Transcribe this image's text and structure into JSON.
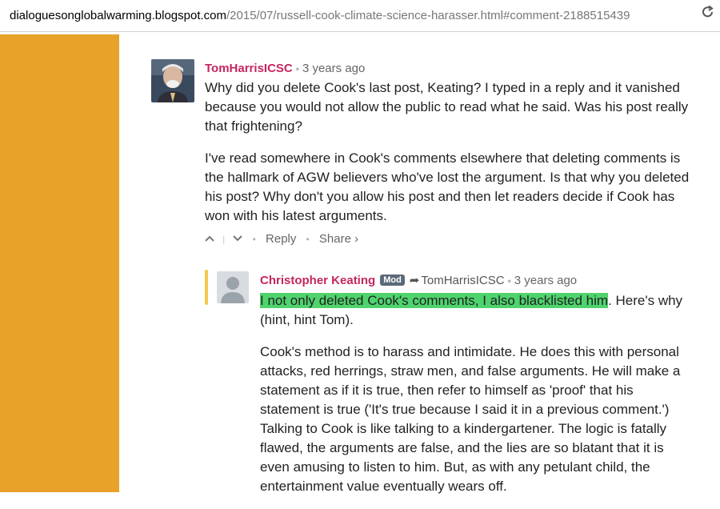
{
  "browser": {
    "url_host": "dialoguesonglobalwarming.blogspot.com",
    "url_path": "/2015/07/russell-cook-climate-science-harasser.html#comment-2188515439",
    "reload_icon": "reload-icon"
  },
  "comments": [
    {
      "author": "TomHarrisICSC",
      "time": "3 years ago",
      "avatar_icon": "user-photo-avatar",
      "paragraphs": [
        "Why did you delete Cook's last post, Keating? I typed in a reply and it vanished because you would not allow the public to read what he said. Was his post really that frightening?",
        "I've read somewhere in Cook's comments elsewhere that deleting comments is the hallmark of AGW believers who've lost the argument. Is that why you deleted his post? Why don't you allow his post and then let readers decide if Cook has won with his latest arguments."
      ],
      "actions": {
        "upvote_icon": "upvote-icon",
        "downvote_icon": "downvote-icon",
        "reply": "Reply",
        "share": "Share ›"
      }
    },
    {
      "author": "Christopher Keating",
      "badge": "Mod",
      "reply_to": "TomHarrisICSC",
      "time": "3 years ago",
      "avatar_icon": "default-avatar",
      "highlight_text": "I not only deleted Cook's comments, I also blacklisted him",
      "after_highlight": ". Here's why (hint, hint Tom).",
      "paragraphs": [
        "Cook's method is to harass and intimidate. He does this with personal attacks, red herrings, straw men, and false arguments. He will make a statement as if it is true, then refer to himself as 'proof' that his statement is true ('It's true because I said it in a previous comment.') Talking to Cook is like talking to a kindergartener. The logic is fatally flawed, the arguments are false, and the lies are so blatant that it is even amusing to listen to him. But, as with any petulant child, the entertainment value eventually wears off."
      ]
    }
  ],
  "colors": {
    "sidebar": "#e8a22a",
    "author": "#c4265f",
    "highlight": "#4fd36d",
    "reply_bar": "#f2c94c"
  }
}
